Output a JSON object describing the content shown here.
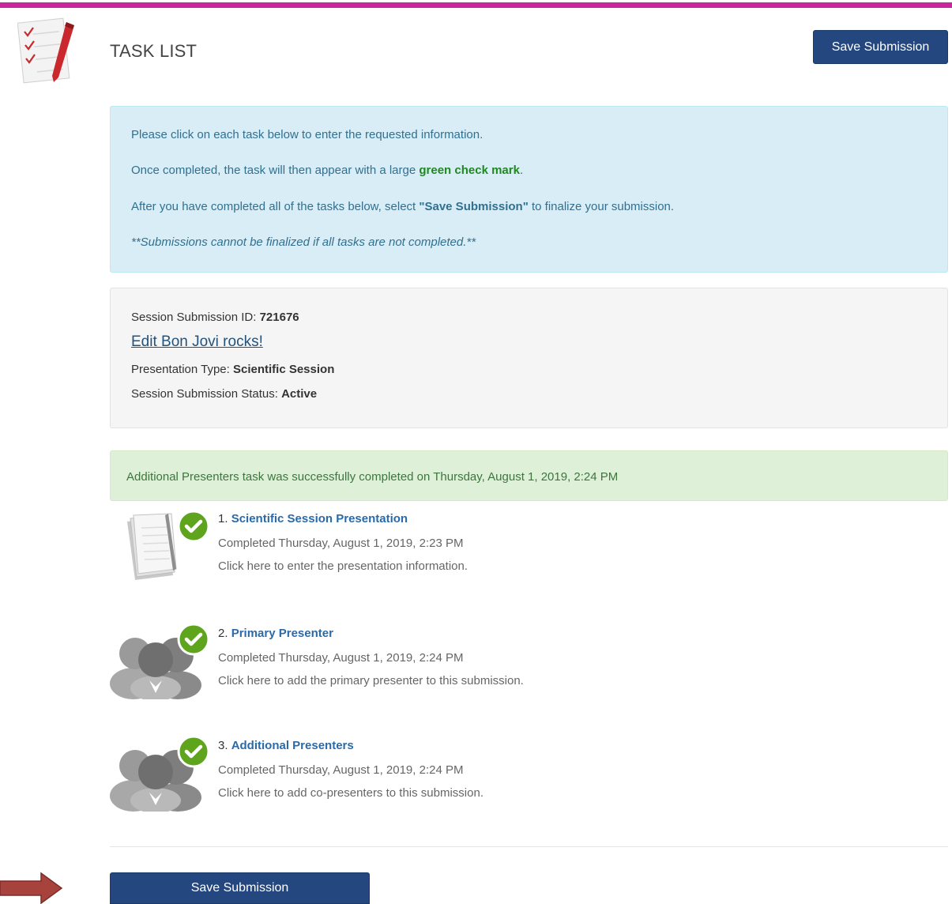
{
  "header": {
    "title": "TASK LIST",
    "save_button_label": "Save Submission",
    "icon": "checklist-pencil-icon"
  },
  "instructions": {
    "line1": "Please click on each task below to enter the requested information.",
    "line2_prefix": "Once completed, the task will then appear with a large ",
    "line2_highlight": "green check mark",
    "line2_suffix": ".",
    "line3_prefix": "After you have completed all of the tasks below, select ",
    "line3_bold": "\"Save Submission\"",
    "line3_suffix": " to finalize your submission.",
    "line4": "**Submissions cannot be finalized if all tasks are not completed.**"
  },
  "session": {
    "id_label": "Session Submission ID: ",
    "id_value": "721676",
    "edit_link": "Edit Bon Jovi rocks!",
    "type_label": "Presentation Type: ",
    "type_value": "Scientific Session",
    "status_label": "Session Submission Status: ",
    "status_value": "Active"
  },
  "success_message": "Additional Presenters task was successfully completed on Thursday, August 1, 2019, 2:24 PM",
  "tasks": [
    {
      "number": "1. ",
      "title": "Scientific Session Presentation",
      "status": "Completed Thursday, August 1, 2019, 2:23 PM",
      "description": "Click here to enter the presentation information.",
      "icon": "documents-icon"
    },
    {
      "number": "2. ",
      "title": "Primary Presenter",
      "status": "Completed Thursday, August 1, 2019, 2:24 PM",
      "description": "Click here to add the primary presenter to this submission.",
      "icon": "people-icon"
    },
    {
      "number": "3. ",
      "title": "Additional Presenters",
      "status": "Completed Thursday, August 1, 2019, 2:24 PM",
      "description": "Click here to add co-presenters to this submission.",
      "icon": "people-icon"
    }
  ],
  "footer": {
    "save_button_label": "Save Submission"
  },
  "colors": {
    "accent_border": "#c8289a",
    "button_primary": "#23477e",
    "info_bg": "#d9edf7",
    "success_bg": "#dff0d8",
    "check_green": "#5ea41d",
    "arrow": "#a8423d"
  }
}
